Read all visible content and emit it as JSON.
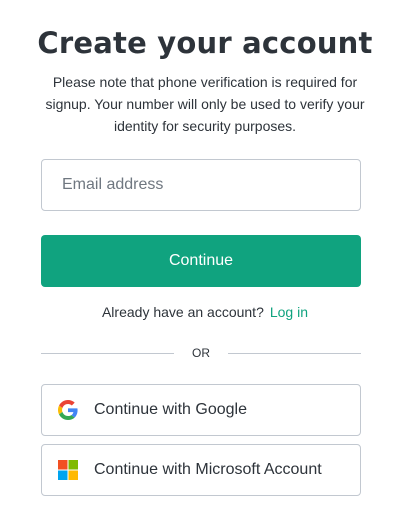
{
  "header": {
    "title": "Create your account",
    "subtitle": "Please note that phone verification is required for signup. Your number will only be used to verify your identity for security purposes."
  },
  "form": {
    "email_placeholder": "Email address",
    "email_value": "",
    "continue_label": "Continue"
  },
  "login": {
    "prompt": "Already have an account?",
    "link_label": "Log in"
  },
  "divider": {
    "label": "OR"
  },
  "social": {
    "google_label": "Continue with Google",
    "google_icon": "google-icon",
    "microsoft_label": "Continue with Microsoft Account",
    "microsoft_icon": "microsoft-icon"
  },
  "colors": {
    "accent": "#10a37f",
    "text": "#2d333a",
    "border": "#c2c8d0"
  }
}
